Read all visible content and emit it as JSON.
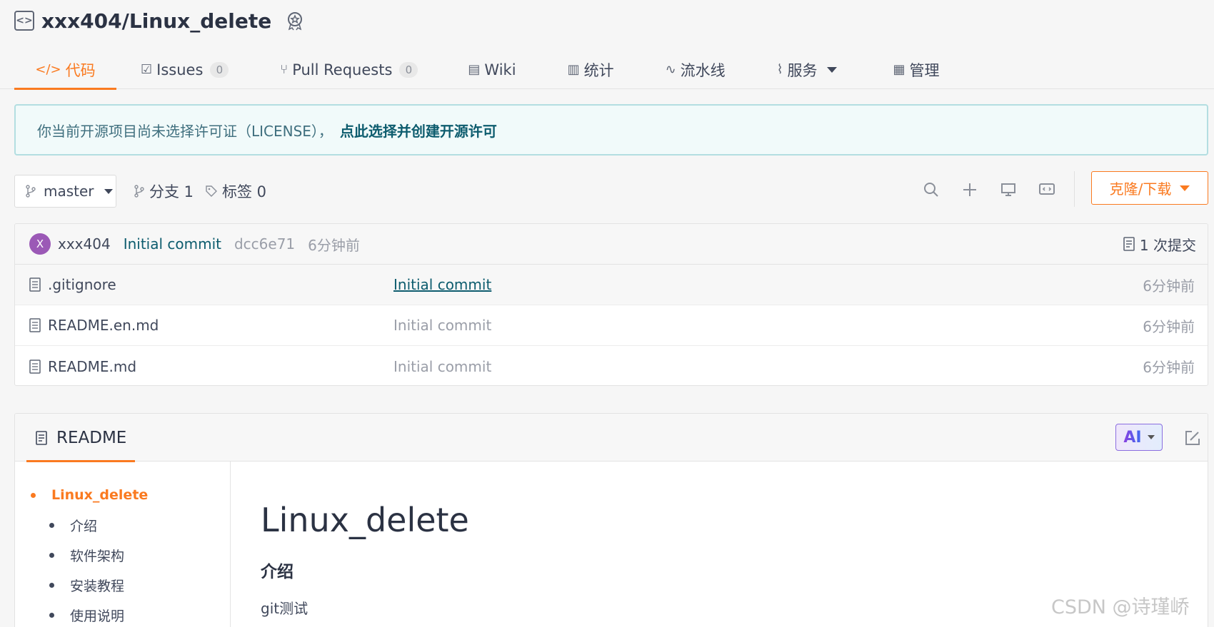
{
  "repo": {
    "title": "xxx404/Linux_delete",
    "icon": "code-box-icon",
    "award_icon": "award-badge-icon"
  },
  "tabs": [
    {
      "label": "代码",
      "icon": "code-icon",
      "active": true
    },
    {
      "label": "Issues",
      "icon": "issues-icon",
      "count": "0"
    },
    {
      "label": "Pull Requests",
      "icon": "pull-request-icon",
      "count": "0"
    },
    {
      "label": "Wiki",
      "icon": "book-icon"
    },
    {
      "label": "统计",
      "icon": "bar-chart-icon"
    },
    {
      "label": "流水线",
      "icon": "pipeline-icon"
    },
    {
      "label": "服务",
      "icon": "pulse-icon",
      "dropdown": true
    },
    {
      "label": "管理",
      "icon": "settings-doc-icon"
    }
  ],
  "notice": {
    "text": "你当前开源项目尚未选择许可证（LICENSE），",
    "link": "点此选择并创建开源许可"
  },
  "toolbar": {
    "branch": "master",
    "branches_label": "分支 1",
    "tags_label": "标签 0",
    "clone_label": "克隆/下载",
    "icons": [
      "search-icon",
      "plus-icon",
      "monitor-icon",
      "comment-code-icon"
    ]
  },
  "last_commit": {
    "avatar_letter": "X",
    "author": "xxx404",
    "message": "Initial commit",
    "hash": "dcc6e71",
    "time": "6分钟前",
    "count_label": "1 次提交"
  },
  "files": [
    {
      "name": ".gitignore",
      "commit": "Initial commit",
      "time": "6分钟前"
    },
    {
      "name": "README.en.md",
      "commit": "Initial commit",
      "time": "6分钟前"
    },
    {
      "name": "README.md",
      "commit": "Initial commit",
      "time": "6分钟前"
    }
  ],
  "readme": {
    "tab_label": "README",
    "ai_label": "AI",
    "toc": [
      {
        "label": "Linux_delete",
        "level": 1
      },
      {
        "label": "介绍",
        "level": 2
      },
      {
        "label": "软件架构",
        "level": 2
      },
      {
        "label": "安装教程",
        "level": 2
      },
      {
        "label": "使用说明",
        "level": 2
      }
    ],
    "h1": "Linux_delete",
    "h2": "介绍",
    "paragraph": "git测试"
  },
  "watermark": "CSDN @诗瑾峤",
  "colors": {
    "accent": "#fa7a20",
    "link": "#0d5c6e",
    "avatar": "#9b59b6"
  }
}
